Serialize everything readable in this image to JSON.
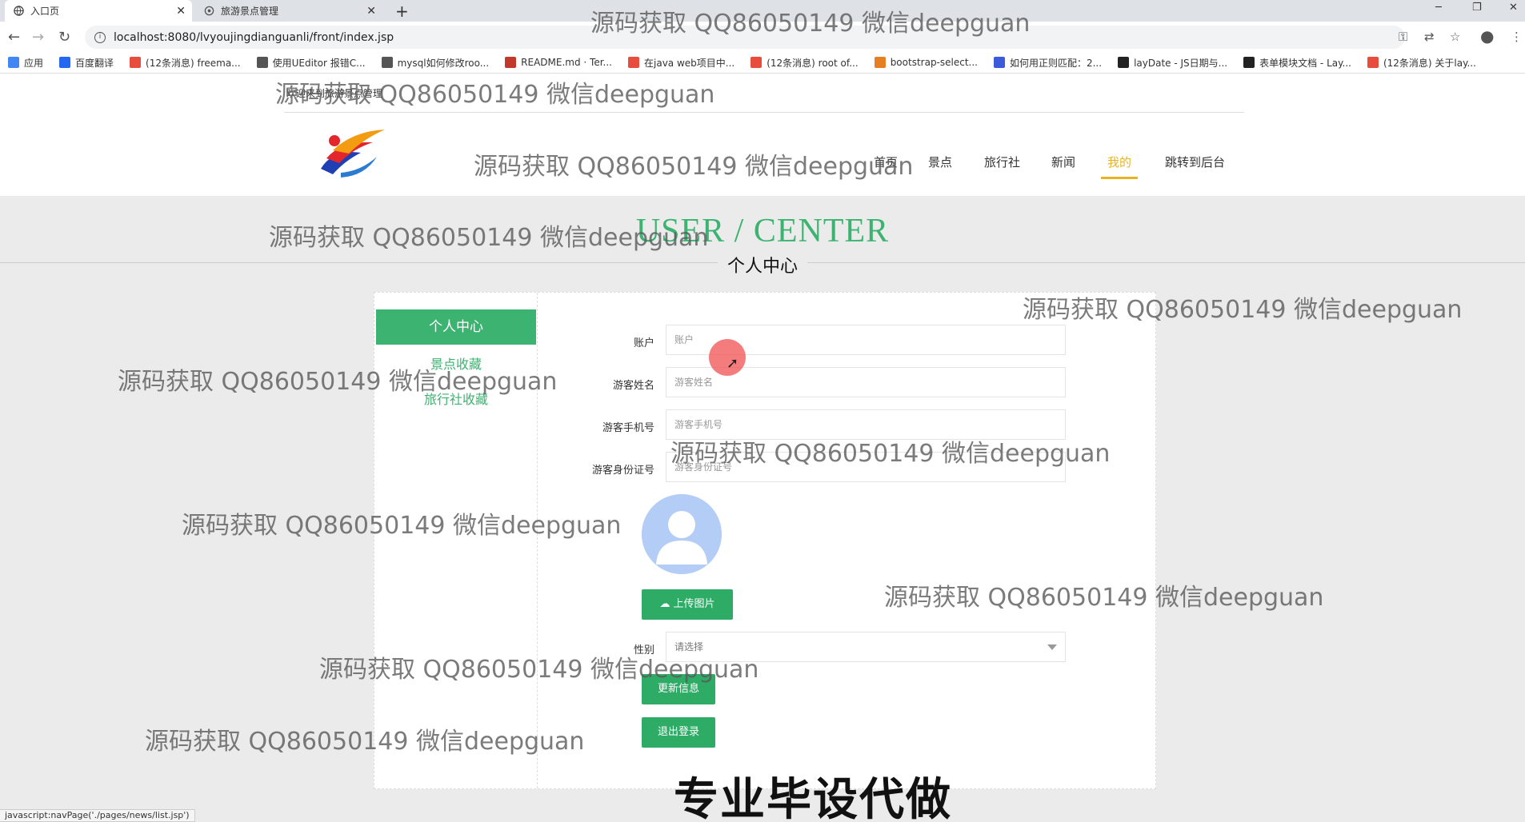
{
  "browser": {
    "tabs": [
      {
        "title": "入口页",
        "active": true
      },
      {
        "title": "旅游景点管理",
        "active": false
      }
    ],
    "url": "localhost:8080/lvyoujingdianguanli/front/index.jsp",
    "bookmarks": [
      {
        "label": "应用",
        "color": "#4285f4"
      },
      {
        "label": "百度翻译",
        "color": "#2468f2"
      },
      {
        "label": "(12条消息) freema...",
        "color": "#e74c3c"
      },
      {
        "label": "使用UEditor 报错C...",
        "color": "#555555"
      },
      {
        "label": "mysql如何修改roo...",
        "color": "#555555"
      },
      {
        "label": "README.md · Ter...",
        "color": "#c0392b"
      },
      {
        "label": "在java web项目中...",
        "color": "#e74c3c"
      },
      {
        "label": "(12条消息) root of...",
        "color": "#e74c3c"
      },
      {
        "label": "bootstrap-select...",
        "color": "#e67e22"
      },
      {
        "label": "如何用正则匹配：2...",
        "color": "#3b5bdb"
      },
      {
        "label": "layDate - JS日期与...",
        "color": "#222222"
      },
      {
        "label": "表单模块文档 - Lay...",
        "color": "#222222"
      },
      {
        "label": "(12条消息) 关于lay...",
        "color": "#e74c3c"
      }
    ]
  },
  "header": {
    "welcome": "欢迎来到旅游景点管理",
    "nav": [
      {
        "label": "首页",
        "active": false
      },
      {
        "label": "景点",
        "active": false
      },
      {
        "label": "旅行社",
        "active": false
      },
      {
        "label": "新闻",
        "active": false
      },
      {
        "label": "我的",
        "active": true
      },
      {
        "label": "跳转到后台",
        "active": false
      }
    ]
  },
  "banner": {
    "title": "USER / CENTER",
    "subtitle": "个人中心"
  },
  "sidebar": {
    "items": [
      {
        "label": "个人中心",
        "active": true
      },
      {
        "label": "景点收藏",
        "active": false
      },
      {
        "label": "旅行社收藏",
        "active": false
      }
    ]
  },
  "form": {
    "account": {
      "label": "账户",
      "placeholder": "账户"
    },
    "name": {
      "label": "游客姓名",
      "placeholder": "游客姓名"
    },
    "phone": {
      "label": "游客手机号",
      "placeholder": "游客手机号"
    },
    "idcard": {
      "label": "游客身份证号",
      "placeholder": "游客身份证号"
    },
    "upload_label": "上传图片",
    "gender": {
      "label": "性别",
      "value": "请选择"
    },
    "update_label": "更新信息",
    "logout_label": "退出登录"
  },
  "watermark": "源码获取 QQ86050149 微信deepguan",
  "caption": "专业毕设代做",
  "status_text": "javascript:navPage('./pages/news/list.jsp')",
  "colors": {
    "accent": "#3cb371",
    "button": "#2eac66",
    "nav_active": "#e6b422"
  }
}
